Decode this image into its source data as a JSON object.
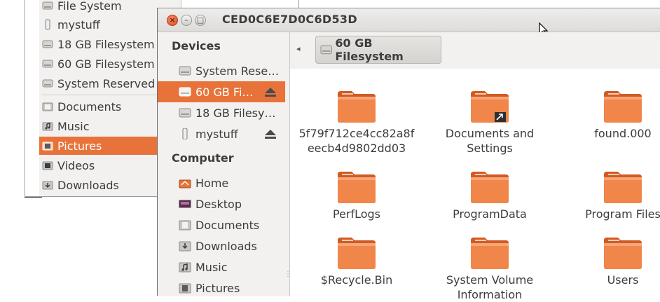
{
  "back_window": {
    "items": [
      {
        "label": "File System",
        "icon": "drive-icon"
      },
      {
        "label": "mystuff",
        "icon": "usb-icon"
      },
      {
        "label": "18 GB Filesystem",
        "icon": "drive-icon"
      },
      {
        "label": "60 GB Filesystem",
        "icon": "drive-icon"
      },
      {
        "label": "System Reserved",
        "icon": "drive-icon"
      },
      {
        "label": "Documents",
        "icon": "folder-documents-icon"
      },
      {
        "label": "Music",
        "icon": "folder-music-icon"
      },
      {
        "label": "Pictures",
        "icon": "folder-pictures-icon"
      },
      {
        "label": "Videos",
        "icon": "folder-videos-icon"
      },
      {
        "label": "Downloads",
        "icon": "folder-downloads-icon"
      }
    ],
    "selected": "Pictures"
  },
  "window": {
    "title": "CED0C6E7D0C6D53D",
    "controls": {
      "close": "×",
      "minimize": "–",
      "maximize": "□"
    }
  },
  "sidebar": {
    "devices_header": "Devices",
    "devices": [
      {
        "label": "System Rese…",
        "icon": "drive-icon",
        "eject": false
      },
      {
        "label": "60 GB Fi…",
        "icon": "drive-icon",
        "eject": true,
        "selected": true
      },
      {
        "label": "18 GB Filesy…",
        "icon": "drive-icon",
        "eject": false
      },
      {
        "label": "mystuff",
        "icon": "usb-icon",
        "eject": true
      }
    ],
    "computer_header": "Computer",
    "computer": [
      {
        "label": "Home",
        "icon": "home-icon"
      },
      {
        "label": "Desktop",
        "icon": "desktop-icon"
      },
      {
        "label": "Documents",
        "icon": "folder-documents-icon"
      },
      {
        "label": "Downloads",
        "icon": "folder-downloads-icon"
      },
      {
        "label": "Music",
        "icon": "folder-music-icon"
      },
      {
        "label": "Pictures",
        "icon": "folder-pictures-icon"
      }
    ]
  },
  "pathbar": {
    "back_arrow": "◂",
    "current": "60 GB Filesystem"
  },
  "files": [
    {
      "name": "5f79f712ce4cc82a8f eecb4d9802dd03",
      "line1": "5f79f712ce4cc82a8f",
      "line2": "eecb4d9802dd03",
      "link": false
    },
    {
      "name": "Documents and Settings",
      "line1": "Documents and",
      "line2": "Settings",
      "link": true
    },
    {
      "name": "found.000",
      "line1": "found.000",
      "line2": "",
      "link": false
    },
    {
      "name": "PerfLogs",
      "line1": "PerfLogs",
      "line2": "",
      "link": false
    },
    {
      "name": "ProgramData",
      "line1": "ProgramData",
      "line2": "",
      "link": false
    },
    {
      "name": "Program Files",
      "line1": "Program Files",
      "line2": "",
      "link": false
    },
    {
      "name": "$Recycle.Bin",
      "line1": "$Recycle.Bin",
      "line2": "",
      "link": false
    },
    {
      "name": "System Volume Information",
      "line1": "System Volume",
      "line2": "Information",
      "link": false
    },
    {
      "name": "Users",
      "line1": "Users",
      "line2": "",
      "link": false
    }
  ],
  "colors": {
    "accent": "#e8733a",
    "folder_top": "#f4a06e",
    "folder_body": "#e0672c"
  }
}
